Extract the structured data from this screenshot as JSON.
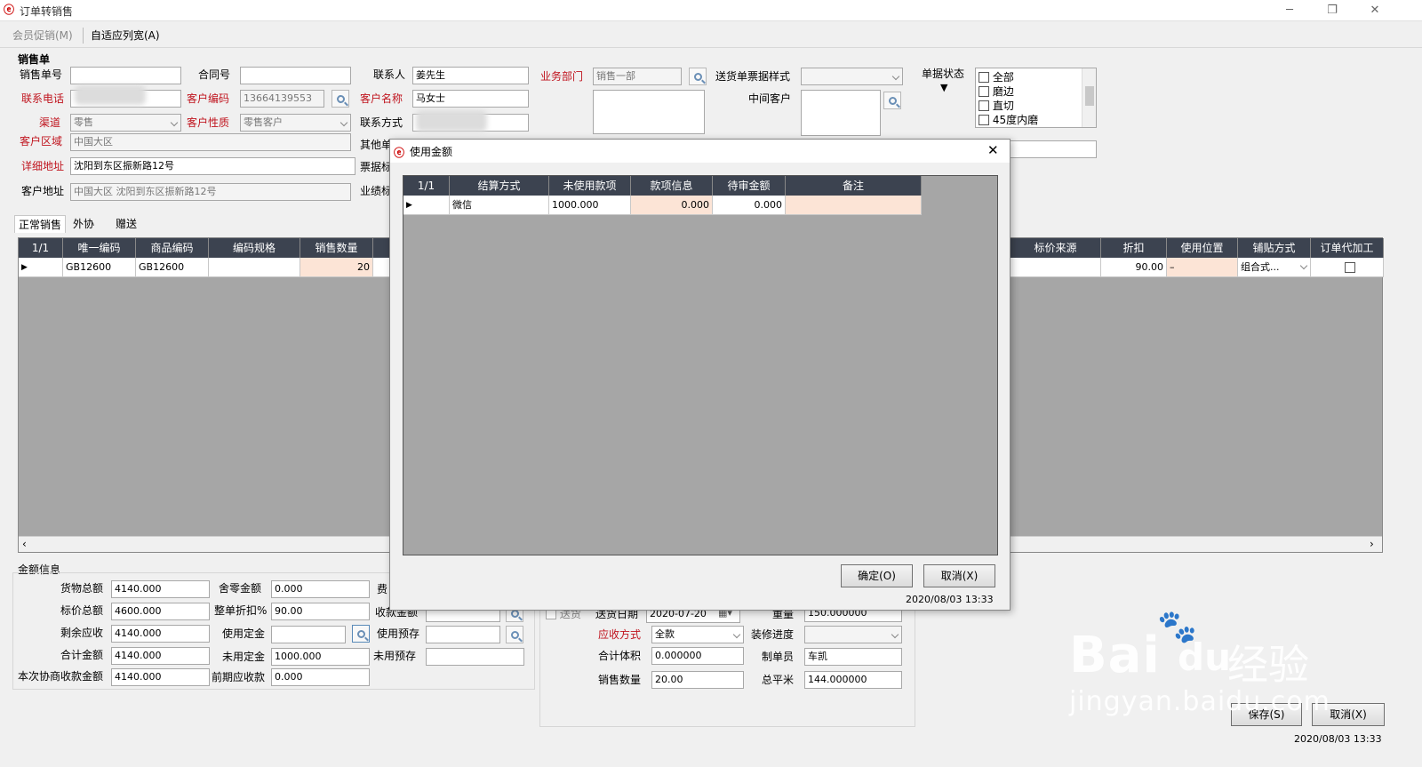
{
  "window": {
    "title": "订单转销售"
  },
  "toolbar": {
    "member_promo": "会员促销(M)",
    "auto_width": "自适应列宽(A)"
  },
  "form": {
    "section": "销售单",
    "sales_no_label": "销售单号",
    "sales_no": "",
    "contract_label": "合同号",
    "contract": "",
    "contact_label": "联系人",
    "contact": "姜先生",
    "dept_label": "业务部门",
    "dept": "销售一部",
    "ticket_style_label": "送货单票据样式",
    "ticket_style": "",
    "status_label": "单据状态",
    "status_options": [
      "全部",
      "磨边",
      "直切",
      "45度内磨"
    ],
    "phone_label": "联系电话",
    "phone": "",
    "cust_code_label": "客户编码",
    "cust_code": "13664139553",
    "cust_name_label": "客户名称",
    "cust_name": "马女士",
    "mid_cust_label": "中间客户",
    "channel_label": "渠道",
    "channel": "零售",
    "cust_type_label": "客户性质",
    "cust_type": "零售客户",
    "contact_method_label": "联系方式",
    "region_label": "客户区域",
    "region": "中国大区",
    "other_label": "其他单",
    "detail_addr_label": "详细地址",
    "detail_addr": "沈阳到东区振新路12号",
    "ticket_label": "票据标",
    "cust_addr_label": "客户地址",
    "cust_addr": "中国大区 沈阳到东区振新路12号",
    "perf_label": "业绩标"
  },
  "tabs": [
    "正常销售",
    "外协",
    "赠送"
  ],
  "main_grid": {
    "counter": "1/1",
    "headers_left": [
      "唯一编码",
      "商品编码",
      "编码规格",
      "销售数量"
    ],
    "headers_right": [
      "标价来源",
      "折扣",
      "使用位置",
      "铺贴方式",
      "订单代加工"
    ],
    "row": {
      "unique": "GB12600",
      "code": "GB12600",
      "spec": "",
      "qty": "20",
      "price_src": "",
      "discount": "90.00",
      "position": "–",
      "paving": "组合式..."
    }
  },
  "amount": {
    "section": "金额信息",
    "goods_total_label": "货物总额",
    "goods_total": "4140.000",
    "round_label": "舍零金额",
    "round": "0.000",
    "fee_label": "费",
    "list_total_label": "标价总额",
    "list_total": "4600.000",
    "discount_label": "整单折扣%",
    "discount": "90.00",
    "received_label": "收款金额",
    "remain_label": "剩余应收",
    "remain": "4140.000",
    "use_deposit_label": "使用定金",
    "use_deposit": "",
    "use_prestore_label": "使用预存",
    "sum_label": "合计金额",
    "sum": "4140.000",
    "unused_deposit_label": "未用定金",
    "unused_deposit": "1000.000",
    "unused_prestore_label": "未用预存",
    "coop_label": "本次协商收款金额",
    "coop": "4140.000",
    "prev_recv_label": "前期应收款",
    "prev_recv": "0.000"
  },
  "delivery": {
    "ship_label": "送货",
    "date_label": "送货日期",
    "date": "2020-07-20",
    "weight_label": "重量",
    "weight": "150.000000",
    "pay_label": "应收方式",
    "pay": "全款",
    "progress_label": "装修进度",
    "progress": "",
    "volume_label": "合计体积",
    "volume": "0.000000",
    "maker_label": "制单员",
    "maker": "车凯",
    "qty_label": "销售数量",
    "qty": "20.00",
    "area_label": "总平米",
    "area": "144.000000"
  },
  "bottom": {
    "save": "保存(S)",
    "cancel": "取消(X)",
    "timestamp": "2020/08/03 13:33"
  },
  "dialog": {
    "title": "使用金额",
    "counter": "1/1",
    "headers": [
      "结算方式",
      "未使用款项",
      "款项信息",
      "待审金额",
      "备注"
    ],
    "row": {
      "method": "微信",
      "unused": "1000.000",
      "info": "0.000",
      "pending": "0.000",
      "remark": ""
    },
    "ok": "确定(O)",
    "cancel": "取消(X)",
    "timestamp": "2020/08/03 13:33"
  },
  "watermark": {
    "brand": "Bai",
    "du": "du",
    "jy": "经验",
    "url": "jingyan.baidu.com"
  }
}
